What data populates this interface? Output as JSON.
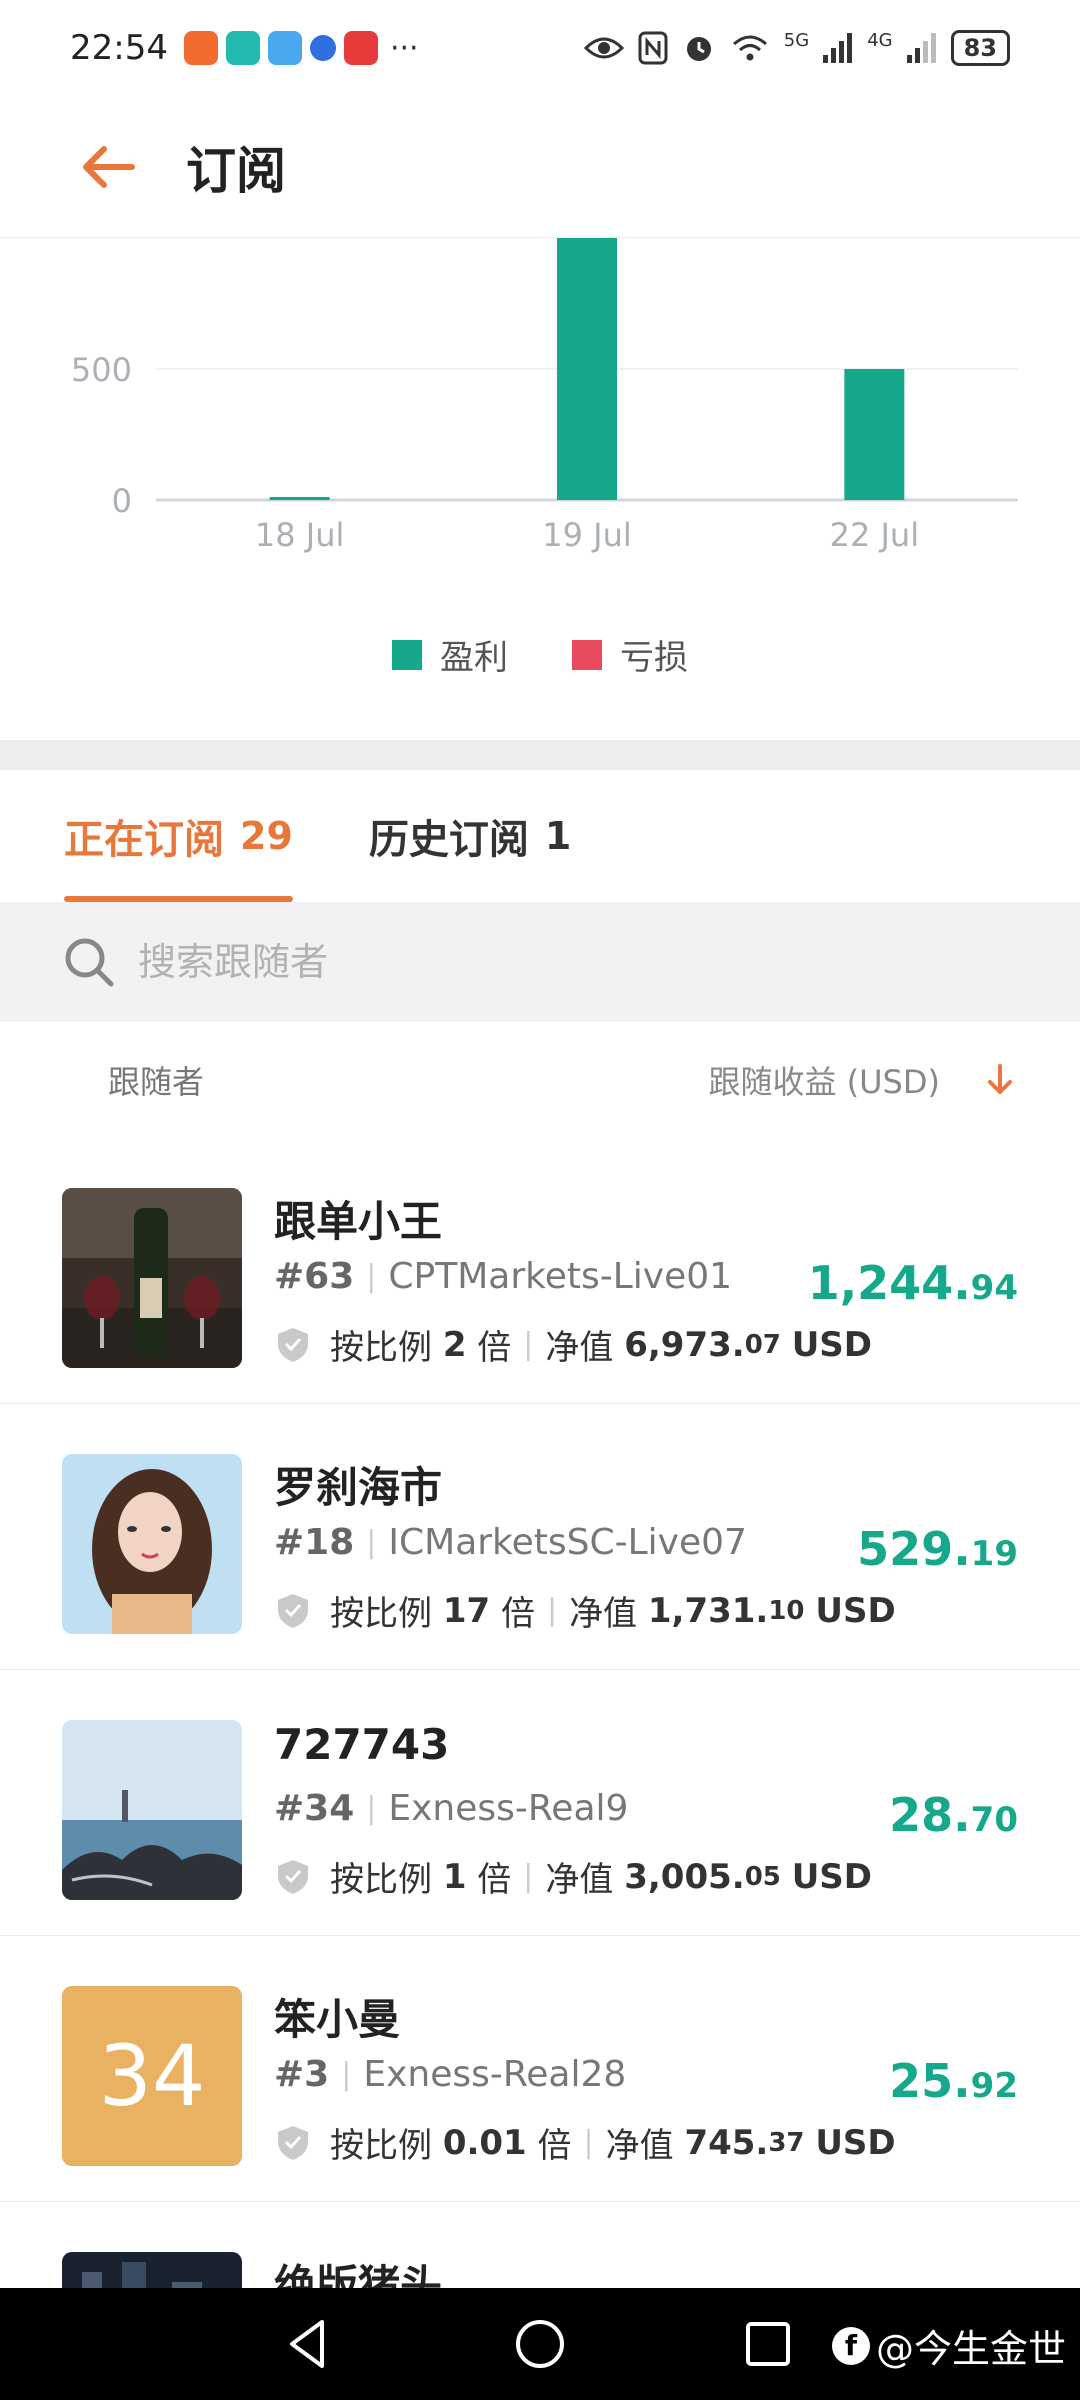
{
  "status_bar": {
    "time": "22:54",
    "more": "···",
    "signal_5g": "5G",
    "signal_4g": "4G",
    "battery": "83"
  },
  "header": {
    "title": "订阅"
  },
  "chart_data": {
    "type": "bar",
    "categories": [
      "18 Jul",
      "19 Jul",
      "22 Jul"
    ],
    "series": [
      {
        "name": "盈利",
        "values": [
          5,
          1000,
          500
        ],
        "color": "#16a88a"
      },
      {
        "name": "亏损",
        "values": [
          0,
          0,
          0
        ],
        "color": "#e84a5f"
      }
    ],
    "yticks": [
      0,
      500
    ],
    "ylim": [
      0,
      1000
    ],
    "legend_position": "bottom",
    "grid": true
  },
  "tabs": [
    {
      "label": "正在订阅",
      "count": "29",
      "active": true
    },
    {
      "label": "历史订阅",
      "count": "1",
      "active": false
    }
  ],
  "search": {
    "placeholder": "搜索跟随者"
  },
  "list_header": {
    "left": "跟随者",
    "right": "跟随收益 (USD)"
  },
  "followers": [
    {
      "name": "跟单小王",
      "rank": "#63",
      "server": "CPTMarkets-Live01",
      "ratio_label": "按比例",
      "ratio_value": "2",
      "ratio_unit": "倍",
      "equity_label": "净值",
      "equity_main": "6,973.",
      "equity_cents": "07",
      "equity_currency": "USD",
      "profit_main": "1,244.",
      "profit_cents": "94",
      "avatar": "wine-photo"
    },
    {
      "name": "罗刹海市",
      "rank": "#18",
      "server": "ICMarketsSC-Live07",
      "ratio_label": "按比例",
      "ratio_value": "17",
      "ratio_unit": "倍",
      "equity_label": "净值",
      "equity_main": "1,731.",
      "equity_cents": "10",
      "equity_currency": "USD",
      "profit_main": "529.",
      "profit_cents": "19",
      "avatar": "portrait-photo"
    },
    {
      "name": "727743",
      "rank": "#34",
      "server": "Exness-Real9",
      "ratio_label": "按比例",
      "ratio_value": "1",
      "ratio_unit": "倍",
      "equity_label": "净值",
      "equity_main": "3,005.",
      "equity_cents": "05",
      "equity_currency": "USD",
      "profit_main": "28.",
      "profit_cents": "70",
      "avatar": "sea-photo"
    },
    {
      "name": "笨小曼",
      "rank": "#3",
      "server": "Exness-Real28",
      "ratio_label": "按比例",
      "ratio_value": "0.01",
      "ratio_unit": "倍",
      "equity_label": "净值",
      "equity_main": "745.",
      "equity_cents": "37",
      "equity_currency": "USD",
      "profit_main": "25.",
      "profit_cents": "92",
      "avatar_text": "34"
    },
    {
      "name": "绝版猪头",
      "avatar": "night-photo"
    }
  ],
  "watermark": {
    "text": "@今生金世"
  },
  "colors": {
    "accent": "#e8773b",
    "profit": "#16a88a",
    "loss": "#e84a5f"
  }
}
